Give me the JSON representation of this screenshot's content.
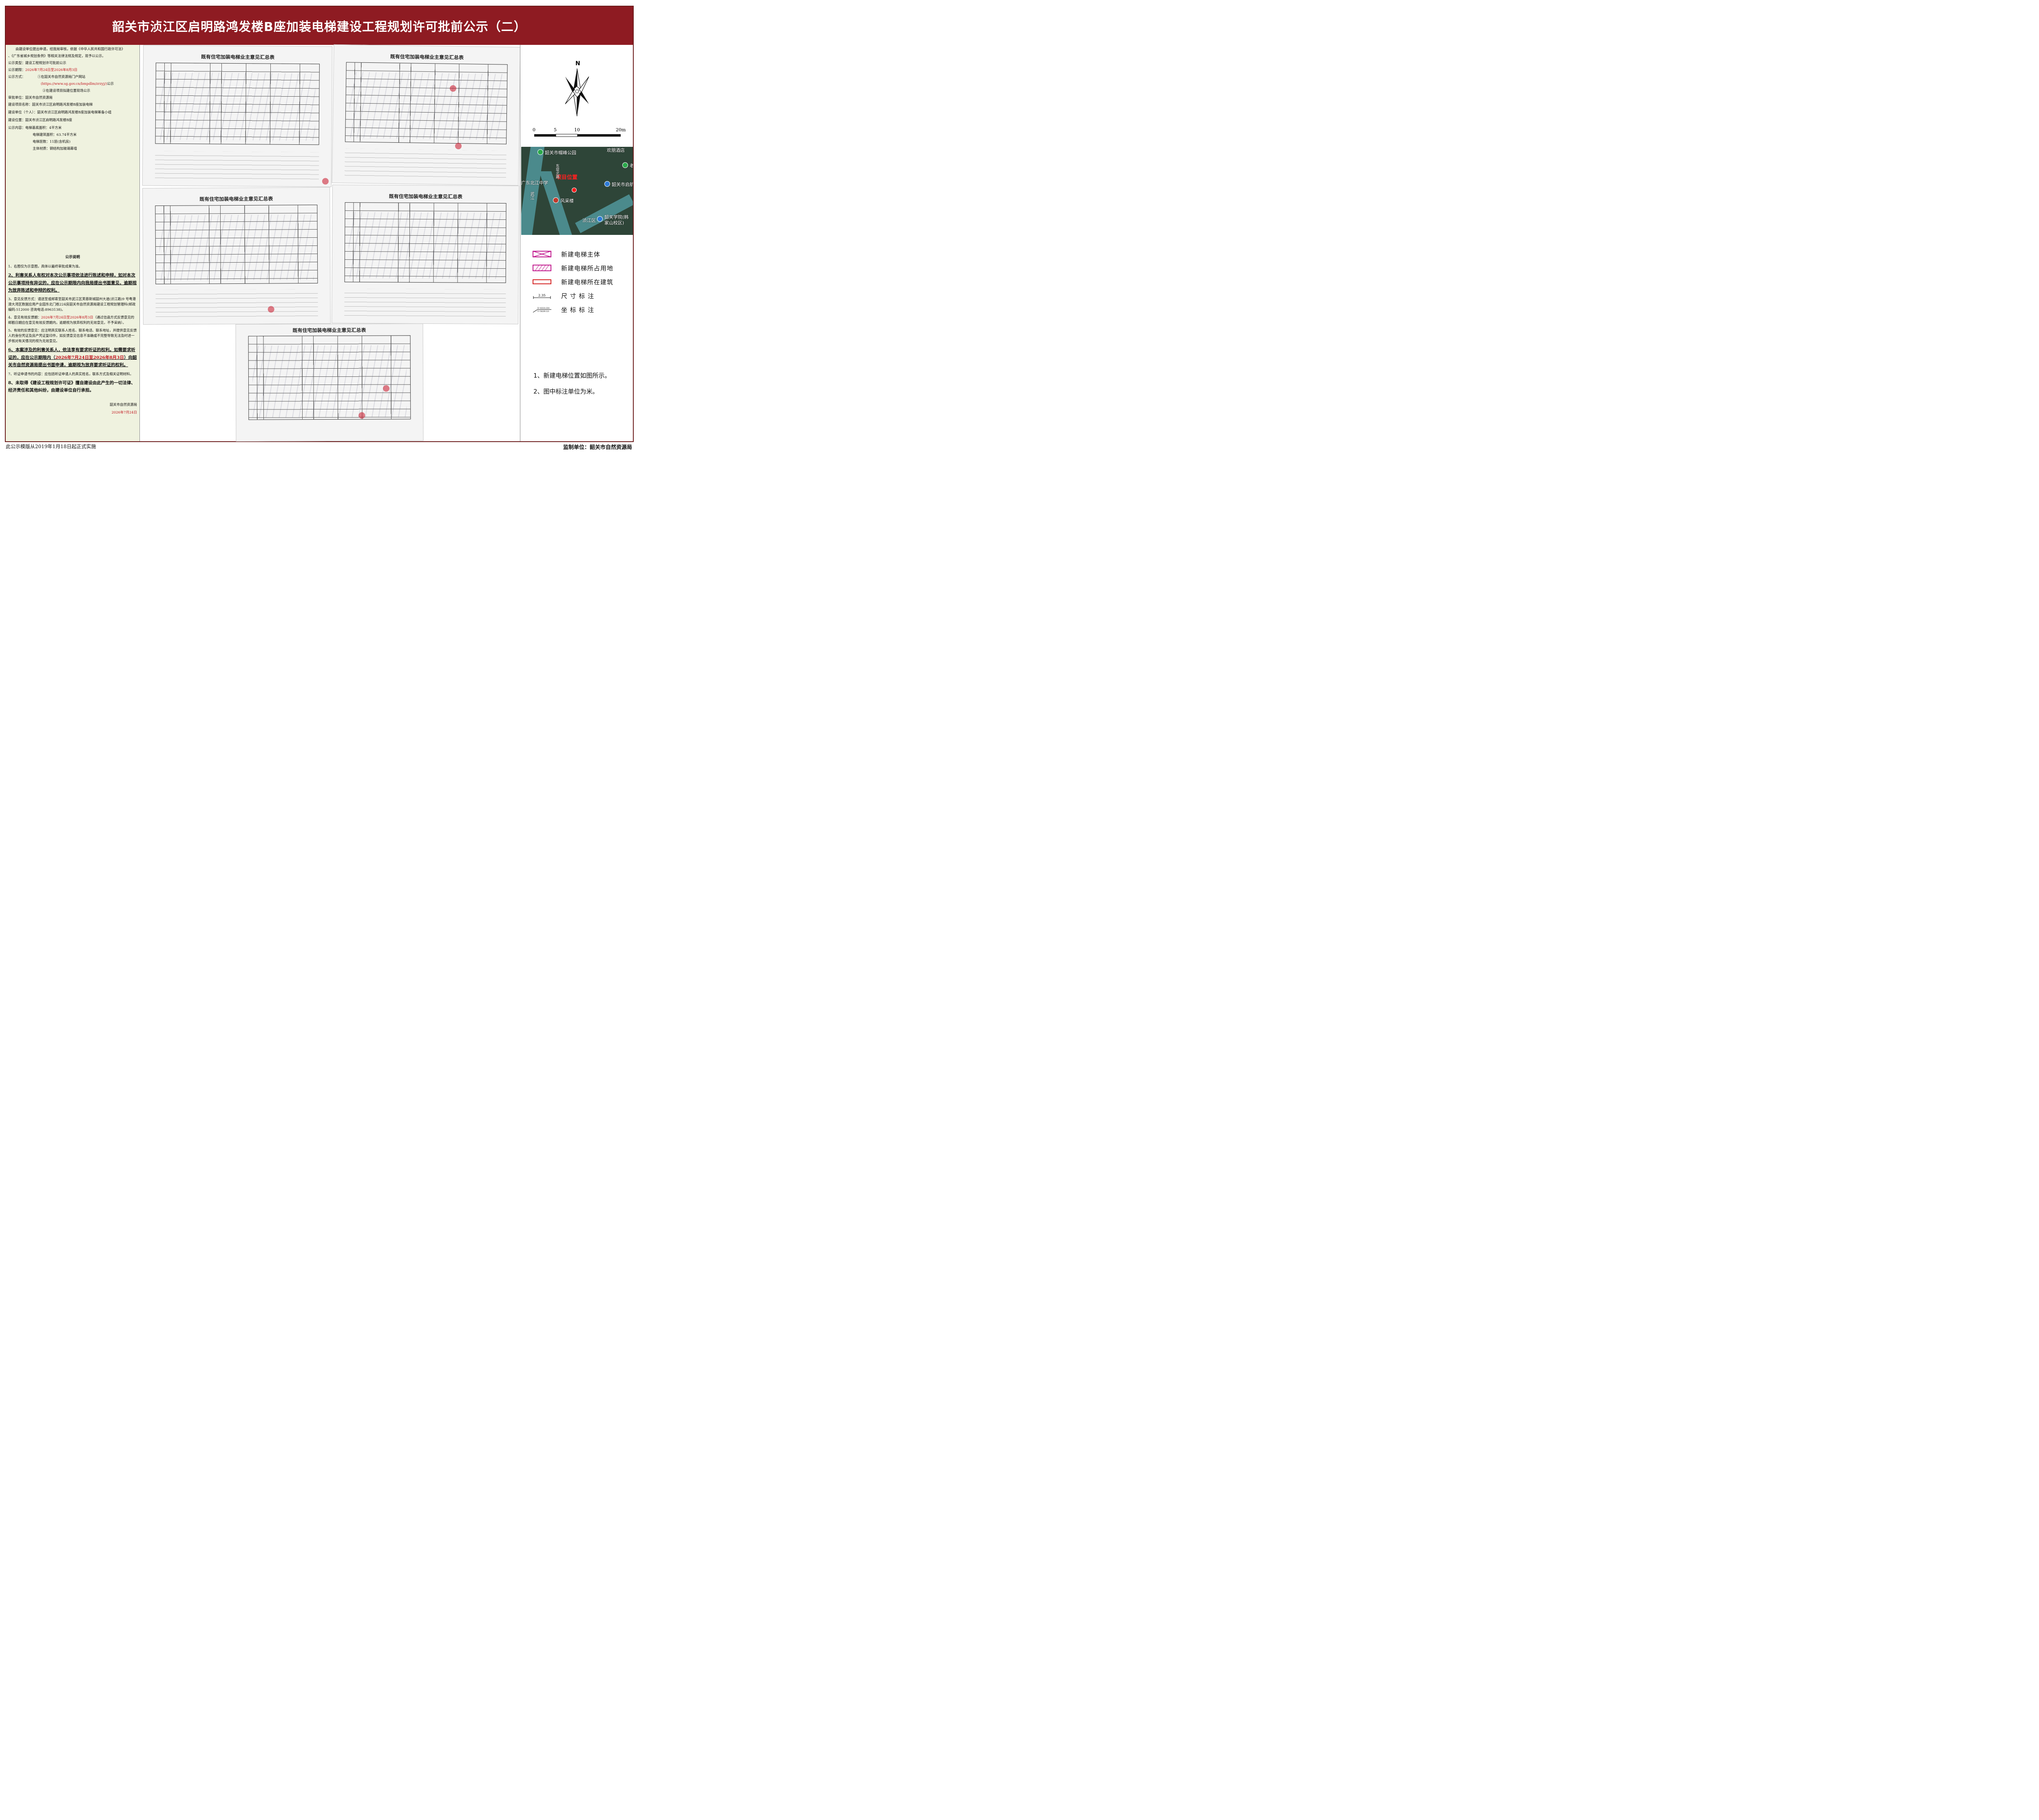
{
  "title": "韶关市浈江区启明路鸿发楼B座加装电梯建设工程规划许可批前公示（二）",
  "left": {
    "intro_1": "由建设单位提出申请，经我局审核，依据《中华人民共和国行政许可法》",
    "intro_2": "、《广东省城乡规划条例》等相关法律法规及规定，现予以公示。",
    "type_label": "公示类型：",
    "type_value": "建设工程规划许可批前公示",
    "period_label": "公示期限：",
    "period_value": "2026年7月24日至2026年8月3日",
    "method_label": "公示方式：",
    "method_1": "①在韶关市自然资源局门户网站",
    "method_url": "(https://www.sg.gov.cn/bmpdlm/zrzyj/)",
    "method_url_suffix": "公示",
    "method_2": "②在建设项目拟建位置现场公示",
    "approver": "审批单位：韶关市自然资源局",
    "project_name": "建设项目名称：韶关市浈江区启明路鸿发楼B座加装电梯",
    "builder": "建设单位（个人）：韶关市浈江区启明路鸿发楼B座加装电梯筹备小组",
    "location": "建设位置：韶关市浈江区启明路鸿发楼B座",
    "content_1": "公示内容：电梯基底面积：4平方米",
    "content_2": "电梯建筑面积：63.74平方米",
    "content_3": "电梯层数：11层(含机房)",
    "content_4": "主体材质：钢结构加玻璃幕墙",
    "notice_title": "公示说明",
    "n1": "1、右图仅为示意图，具体以最终审批成果为准。",
    "n2": "2、利害关系人有权对本次公示事项依法进行陈述和申辩，如对本次公示事项持有异议的，应在公示期限内向我局提出书面意见，逾期视为放弃陈述和申辩的权利。",
    "n3": "3、意见反馈方式：请送至或邮寄至韶关市武江区芙蓉新城韶州大道(浈江路)9 号粤港澳大湾区数据应用产业园东北门栋224房韶关市自然资源局建设工程规划管理科(邮政编码:512000 咨询电话:8963138)。",
    "n4_prefix": "4、意见有效反馈期：",
    "n4_period": "2026年7月24日至2026年8月3日",
    "n4_suffix": "（通过信函方式反馈意见的邮戳日期应在意见有效反馈期内，逾期视为放弃权利的无效意见，不予采纳）。",
    "n5": "5、有效的反馈意见：应注明真实联系人姓名、联系电话、联系地址，并提供意见反馈人的身份凭证及房产凭证复印件，如反馈意见信息不准确或不完整导致无法及时进一步核对有关情况的视为无效意见。",
    "n6_prefix": "6、本案涉及的利害关系人，依法享有要求听证的权利。如需要求听证的，应在公示期限内（",
    "n6_period": "2026年7月24日至2026年8月3日",
    "n6_suffix": "）向韶关市自然资源局提出书面申请，逾期视为放弃要求听证的权利。",
    "n7": "7、听证申请书的内容：应包括听证申请人的真实姓名，联系方式及相关证明材料。",
    "n8": "8、未取得《建设工程规划许可证》擅自建设由此产生的一切法律、经济责任和其他纠纷，由建设单位自行承担。",
    "sign_org": "韶关市自然资源局",
    "sign_date": "2026年7月24日"
  },
  "sheets": {
    "s1": "既有住宅加装电梯业主意见汇总表",
    "s2": "既有住宅加装电梯业主意见汇总表",
    "s3": "既有住宅加装电梯业主意见汇总表",
    "s4": "既有住宅加装电梯业主意见汇总表",
    "s5": "既有住宅加装电梯业主意见汇总表"
  },
  "right": {
    "north": "N",
    "scale_0": "0",
    "scale_5": "5",
    "scale_10": "10",
    "scale_20": "20m",
    "map_labels": {
      "park": "韶关市帽峰公园",
      "hotel": "欢朋酒店",
      "school": "广东北江中学",
      "project": "项目位置",
      "building": "风采楼",
      "district": "浈江区",
      "library": "韶关市启航",
      "college": "韶关学院(韩家山校区)",
      "river": "武江",
      "road_east": "东堤北路",
      "old": "老"
    },
    "legend": [
      "新建电梯主体",
      "新建电梯所占用地",
      "新建电梯所在建筑",
      "尺 寸 标 注",
      "坐 标 标 注"
    ],
    "dim_value": "2.35",
    "coord_x": "X=43331.034",
    "coord_y": "Y=58209.321",
    "notes": [
      "1、新建电梯位置如图所示。",
      "2、图中标注单位为米。"
    ]
  },
  "footer": {
    "left": "此公示模版从2019年1月18日起正式实施",
    "right": "监制单位：韶关市自然资源局"
  },
  "colors": {
    "title_bg": "#8e1b22",
    "panel_bg": "#eff2df",
    "accent_red": "#c0121b",
    "legend_magenta": "#c0178c"
  }
}
